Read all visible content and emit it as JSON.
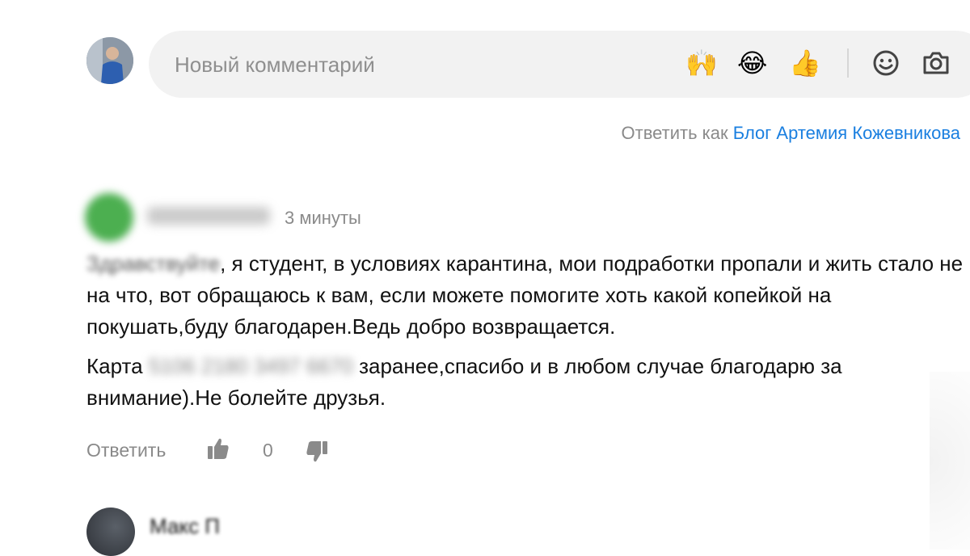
{
  "composer": {
    "placeholder": "Новый комментарий",
    "emojis": [
      {
        "glyph": "🙌",
        "name": "raised-hands-emoji"
      },
      {
        "glyph": "😂",
        "name": "tears-of-joy-emoji"
      },
      {
        "glyph": "👍",
        "name": "thumbs-up-emoji"
      }
    ],
    "tools": [
      "smiley-icon",
      "camera-icon"
    ]
  },
  "reply_as": {
    "prefix": "Ответить как",
    "blog_name": "Блог Артемия Кожевникова"
  },
  "comment": {
    "time": "3 минуты",
    "paragraph1_blurred": "Здравствуйте",
    "paragraph1": ", я студент, в условиях карантина, мои подработки пропали и жить стало не на что, вот обращаюсь к вам, если можете помогите хоть какой копейкой на покушать,буду благодарен.Ведь добро возвращается.",
    "paragraph2_start": "Карта",
    "paragraph2_blurred": "5106 2180 3497 6670",
    "paragraph2_end": "заранее,спасибо и в любом случае благодарю за внимание).Не болейте друзья.",
    "reply_label": "Ответить",
    "likes": "0"
  },
  "next_comment": {
    "name": "Макс П"
  },
  "colors": {
    "link": "#1a7fe0",
    "muted": "#8a8a8a",
    "composer_bg": "#f2f2f2"
  }
}
